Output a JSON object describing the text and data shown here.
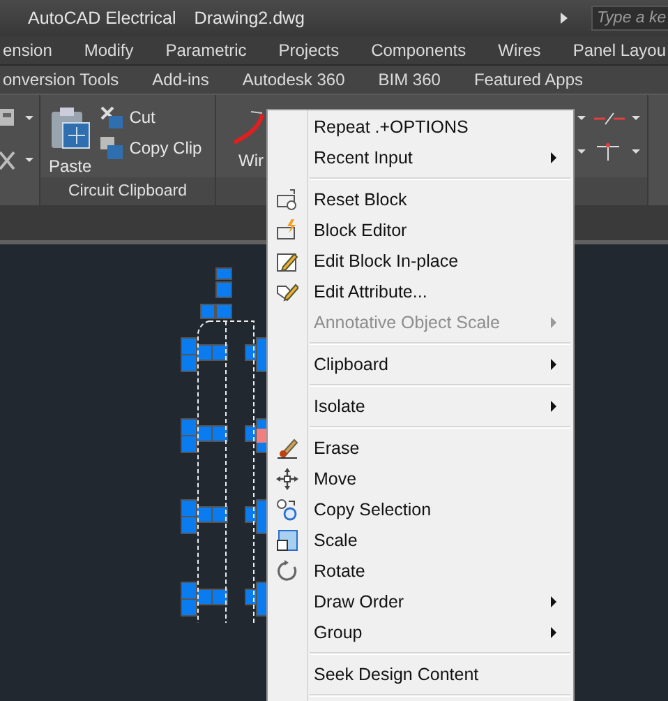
{
  "title_bar": {
    "app": "AutoCAD Electrical",
    "document": "Drawing2.dwg",
    "search": {
      "placeholder": "Type a ke"
    }
  },
  "ribbon_tabs": [
    "ension",
    "Modify",
    "Parametric",
    "Projects",
    "Components",
    "Wires",
    "Panel Layou"
  ],
  "ribbon_tabs_2": [
    "onversion Tools",
    "Add-ins",
    "Autodesk 360",
    "BIM 360",
    "Featured Apps"
  ],
  "ribbon": {
    "panel": {
      "title": "Circuit Clipboard",
      "paste": "Paste",
      "cut": "Cut",
      "copy": "Copy Clip"
    },
    "wire": "Wir"
  },
  "context_menu": {
    "sections": [
      [
        {
          "label": "Repeat .+OPTIONS",
          "disabled": false,
          "submenu": false
        },
        {
          "label": "Recent Input",
          "disabled": false,
          "submenu": true
        }
      ],
      [
        {
          "label": "Reset Block",
          "disabled": false,
          "submenu": false
        },
        {
          "label": "Block Editor",
          "disabled": false,
          "submenu": false
        },
        {
          "label": "Edit Block In-place",
          "disabled": false,
          "submenu": false
        },
        {
          "label": "Edit Attribute...",
          "disabled": false,
          "submenu": false
        },
        {
          "label": "Annotative Object Scale",
          "disabled": true,
          "submenu": true
        }
      ],
      [
        {
          "label": "Clipboard",
          "disabled": false,
          "submenu": true
        }
      ],
      [
        {
          "label": "Isolate",
          "disabled": false,
          "submenu": true
        }
      ],
      [
        {
          "label": "Erase",
          "disabled": false,
          "submenu": false
        },
        {
          "label": "Move",
          "disabled": false,
          "submenu": false
        },
        {
          "label": "Copy Selection",
          "disabled": false,
          "submenu": false
        },
        {
          "label": "Scale",
          "disabled": false,
          "submenu": false
        },
        {
          "label": "Rotate",
          "disabled": false,
          "submenu": false
        },
        {
          "label": "Draw Order",
          "disabled": false,
          "submenu": true
        },
        {
          "label": "Group",
          "disabled": false,
          "submenu": true
        }
      ],
      [
        {
          "label": "Seek Design Content",
          "disabled": false,
          "submenu": false
        }
      ]
    ]
  }
}
